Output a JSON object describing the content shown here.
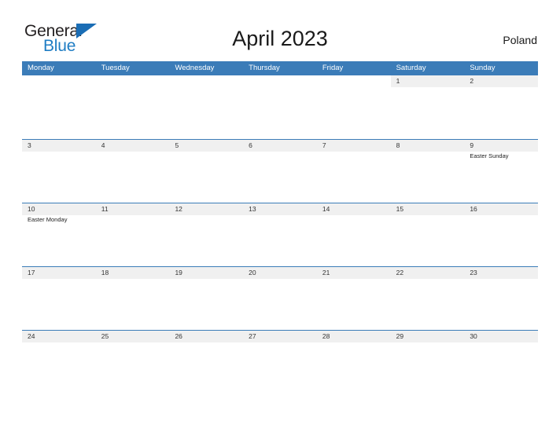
{
  "brand": {
    "name_part1": "General",
    "name_part2": "Blue",
    "flag_icon": "triangle-flag-icon",
    "accent_color": "#1f7dc4"
  },
  "header": {
    "title": "April 2023",
    "country": "Poland"
  },
  "colors": {
    "header_blue": "#3b7cb8",
    "date_band_gray": "#f0f0f0",
    "text_dark": "#1a1a1a"
  },
  "calendar": {
    "month": "April",
    "year": "2023",
    "day_headers": [
      "Monday",
      "Tuesday",
      "Wednesday",
      "Thursday",
      "Friday",
      "Saturday",
      "Sunday"
    ],
    "weeks": [
      [
        {
          "date": "",
          "event": ""
        },
        {
          "date": "",
          "event": ""
        },
        {
          "date": "",
          "event": ""
        },
        {
          "date": "",
          "event": ""
        },
        {
          "date": "",
          "event": ""
        },
        {
          "date": "1",
          "event": ""
        },
        {
          "date": "2",
          "event": ""
        }
      ],
      [
        {
          "date": "3",
          "event": ""
        },
        {
          "date": "4",
          "event": ""
        },
        {
          "date": "5",
          "event": ""
        },
        {
          "date": "6",
          "event": ""
        },
        {
          "date": "7",
          "event": ""
        },
        {
          "date": "8",
          "event": ""
        },
        {
          "date": "9",
          "event": "Easter Sunday"
        }
      ],
      [
        {
          "date": "10",
          "event": "Easter Monday"
        },
        {
          "date": "11",
          "event": ""
        },
        {
          "date": "12",
          "event": ""
        },
        {
          "date": "13",
          "event": ""
        },
        {
          "date": "14",
          "event": ""
        },
        {
          "date": "15",
          "event": ""
        },
        {
          "date": "16",
          "event": ""
        }
      ],
      [
        {
          "date": "17",
          "event": ""
        },
        {
          "date": "18",
          "event": ""
        },
        {
          "date": "19",
          "event": ""
        },
        {
          "date": "20",
          "event": ""
        },
        {
          "date": "21",
          "event": ""
        },
        {
          "date": "22",
          "event": ""
        },
        {
          "date": "23",
          "event": ""
        }
      ],
      [
        {
          "date": "24",
          "event": ""
        },
        {
          "date": "25",
          "event": ""
        },
        {
          "date": "26",
          "event": ""
        },
        {
          "date": "27",
          "event": ""
        },
        {
          "date": "28",
          "event": ""
        },
        {
          "date": "29",
          "event": ""
        },
        {
          "date": "30",
          "event": ""
        }
      ]
    ]
  }
}
